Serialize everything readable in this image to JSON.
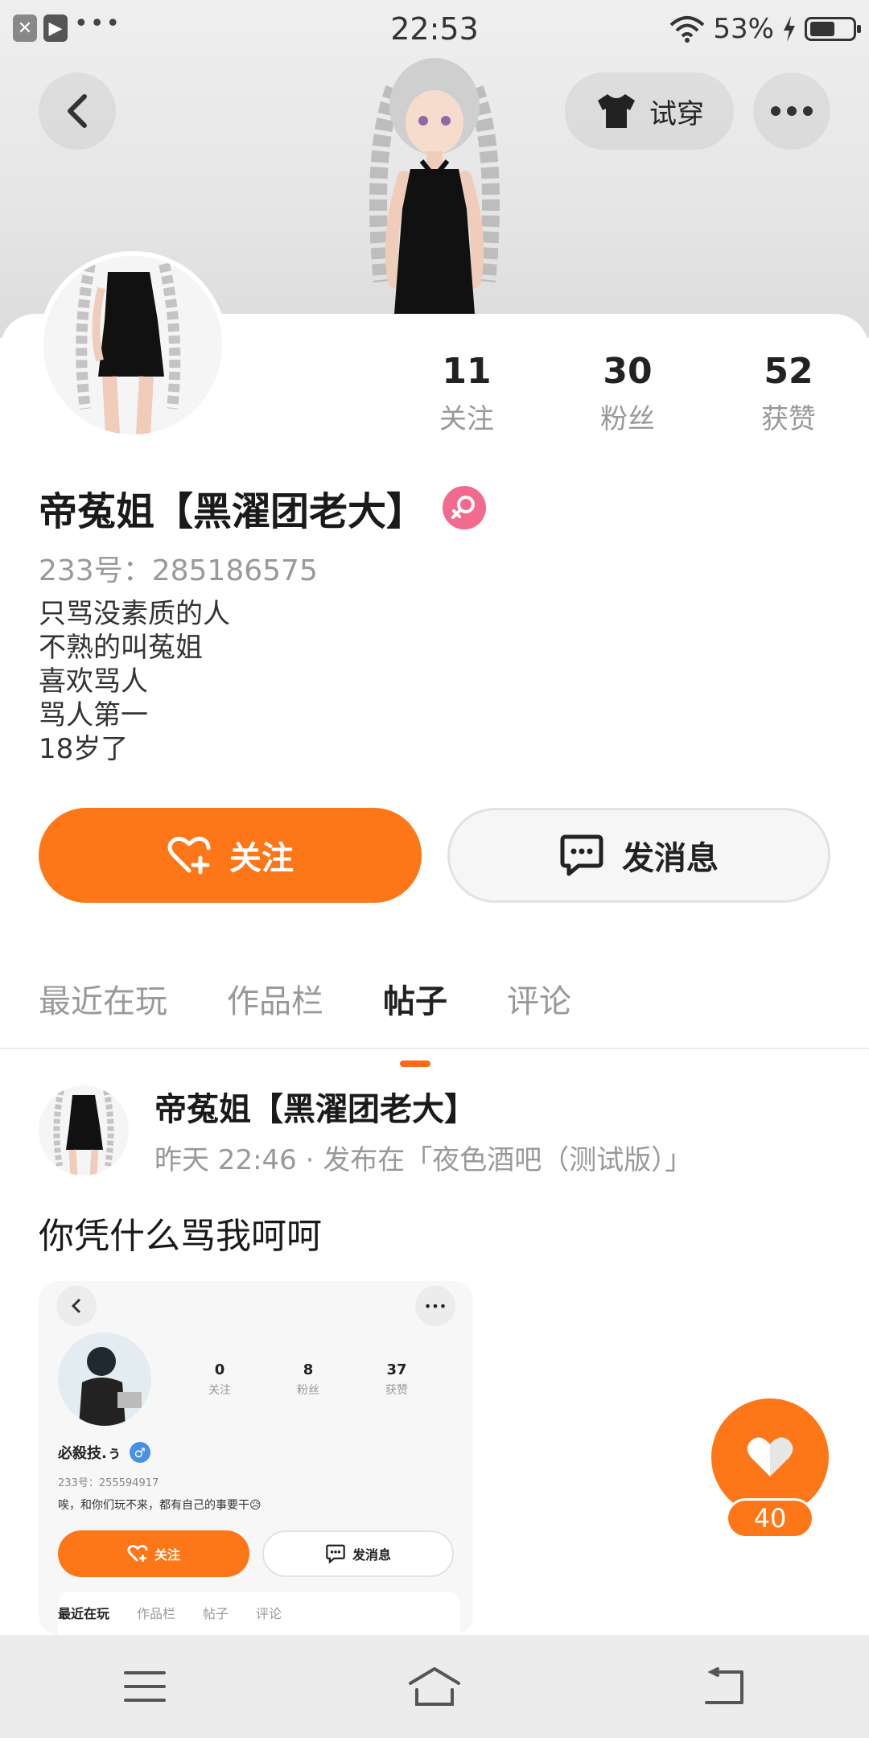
{
  "status_bar": {
    "time": "22:53",
    "battery_percent": "53%",
    "icons": [
      "close-icon",
      "play-icon",
      "more-dots-icon",
      "wifi-icon",
      "charging-icon",
      "battery-icon"
    ]
  },
  "header": {
    "back_icon": "chevron-left-icon",
    "try_on_label": "试穿",
    "try_on_icon": "shirt-icon",
    "more_icon": "more-dots-icon"
  },
  "profile": {
    "stats": [
      {
        "value": "11",
        "label": "关注"
      },
      {
        "value": "30",
        "label": "粉丝"
      },
      {
        "value": "52",
        "label": "获赞"
      }
    ],
    "name": "帝菟姐【黑濯团老大】",
    "gender_icon": "female-icon",
    "gender_color": "#f26a8d",
    "uid": "233号：285186575",
    "bio": [
      "只骂没素质的人",
      "不熟的叫菟姐",
      "喜欢骂人",
      "骂人第一",
      "18岁了"
    ]
  },
  "actions": {
    "follow_label": "关注",
    "message_label": "发消息",
    "accent_color": "#fd7617"
  },
  "tabs": [
    {
      "label": "最近在玩",
      "active": false
    },
    {
      "label": "作品栏",
      "active": false
    },
    {
      "label": "帖子",
      "active": true
    },
    {
      "label": "评论",
      "active": false
    }
  ],
  "post": {
    "author": "帝菟姐【黑濯团老大】",
    "meta": "昨天 22:46 · 发布在「夜色酒吧（测试版）」",
    "text": "你凭什么骂我呵呵",
    "embedded_screenshot": {
      "stats": [
        {
          "value": "0",
          "label": "关注"
        },
        {
          "value": "8",
          "label": "粉丝"
        },
        {
          "value": "37",
          "label": "获赞"
        }
      ],
      "name": "必殺技.ぅ",
      "gender_icon": "male-icon",
      "uid": "233号：255594917",
      "bio": "唉，和你们玩不来，都有自己的事要干😥",
      "follow_label": "关注",
      "message_label": "发消息",
      "tabs": [
        "最近在玩",
        "作品栏",
        "帖子",
        "评论"
      ]
    }
  },
  "like": {
    "count": "40",
    "icon": "heart-icon"
  },
  "nav_bar": {
    "icons": [
      "menu-icon",
      "home-icon",
      "back-icon"
    ]
  }
}
